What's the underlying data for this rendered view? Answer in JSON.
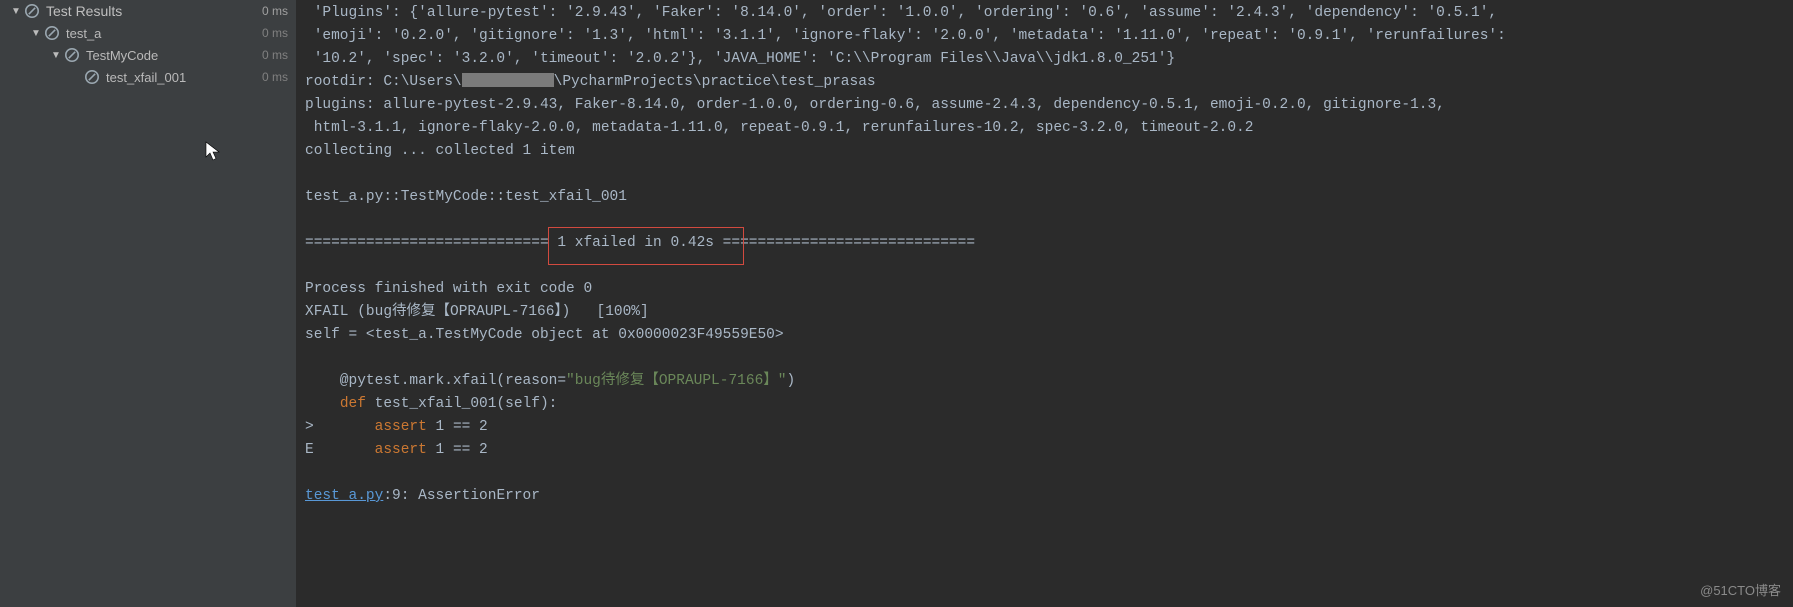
{
  "sidebar": {
    "root": {
      "label": "Test Results",
      "time": "0 ms"
    },
    "items": [
      {
        "label": "test_a",
        "time": "0 ms",
        "has_arrow": true
      },
      {
        "label": "TestMyCode",
        "time": "0 ms",
        "has_arrow": true
      },
      {
        "label": "test_xfail_001",
        "time": "0 ms",
        "has_arrow": false
      }
    ]
  },
  "console": {
    "l0a": " 'Plugins': {'allure-pytest': '2.9.43', 'Faker': '8.14.0', 'order': '1.0.0', 'ordering': '0.6', 'assume': '2.4.3', 'dependency': '0.5.1', ",
    "l0b": " 'emoji': '0.2.0', 'gitignore': '1.3', 'html': '3.1.1', 'ignore-flaky': '2.0.0', 'metadata': '1.11.0', 'repeat': '0.9.1', 'rerunfailures': ",
    "l0c": " '10.2', 'spec': '3.2.0', 'timeout': '2.0.2'}, 'JAVA_HOME': 'C:\\\\Program Files\\\\Java\\\\jdk1.8.0_251'}",
    "l1a": "rootdir: C:\\Users\\",
    "l1b": "\\PycharmProjects\\practice\\test_prasas",
    "l2": "plugins: allure-pytest-2.9.43, Faker-8.14.0, order-1.0.0, ordering-0.6, assume-2.4.3, dependency-0.5.1, emoji-0.2.0, gitignore-1.3,",
    "l3": " html-3.1.1, ignore-flaky-2.0.0, metadata-1.11.0, repeat-0.9.1, rerunfailures-10.2, spec-3.2.0, timeout-2.0.2",
    "l4": "collecting ... collected 1 item",
    "l5": "",
    "l6": "test_a.py::TestMyCode::test_xfail_001 ",
    "l7": "",
    "l8a": "============================ ",
    "l8b": "1 xfailed in 0.42s",
    "l8c": " =============================",
    "l9": "",
    "l10": "Process finished with exit code 0",
    "l11": "XFAIL (bug待修复【OPRAUPL-7166】)   [100%]",
    "l12": "self = <test_a.TestMyCode object at 0x0000023F49559E50>",
    "l13": "",
    "l14a": "    @pytest.mark.xfail(reason=",
    "l14b": "\"bug待修复【OPRAUPL-7166】\"",
    "l14c": ")",
    "l15a": "    ",
    "l15b": "def ",
    "l15c": "test_xfail_001(self):",
    "l16a": ">       ",
    "l16b": "assert ",
    "l16c": "1 == 2",
    "l17a": "E       ",
    "l17b": "assert ",
    "l17c": "1 == 2",
    "l18": "",
    "l19a": "test_a.py",
    "l19b": ":9: AssertionError"
  },
  "watermark": "@51CTO博客"
}
